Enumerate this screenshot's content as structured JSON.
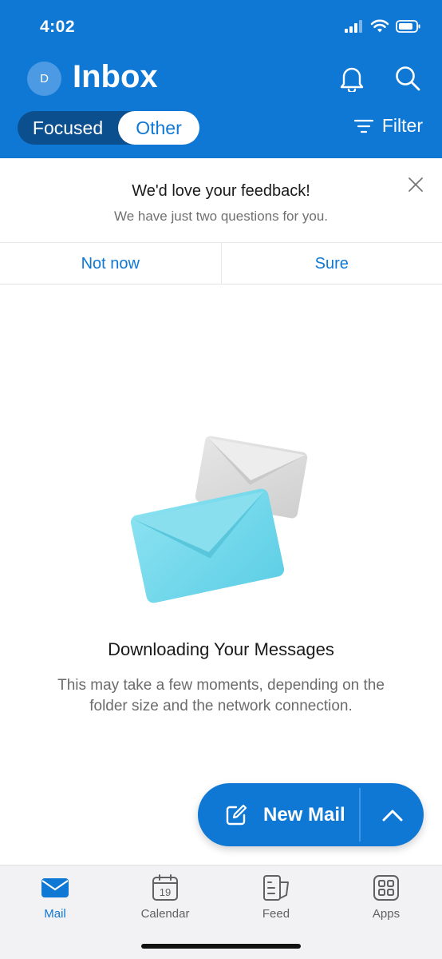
{
  "status": {
    "time": "4:02"
  },
  "header": {
    "avatar_initial": "D",
    "title": "Inbox",
    "tabs": {
      "focused": "Focused",
      "other": "Other",
      "selected": "Other"
    },
    "filter_label": "Filter"
  },
  "feedback": {
    "title": "We'd love your feedback!",
    "subtitle": "We have just two questions for you.",
    "not_now": "Not now",
    "sure": "Sure"
  },
  "empty_state": {
    "title": "Downloading Your Messages",
    "subtitle": "This may take a few moments, depending on the folder size and the network connection."
  },
  "fab": {
    "label": "New Mail"
  },
  "nav": {
    "items": [
      {
        "label": "Mail",
        "icon": "mail-icon",
        "active": true
      },
      {
        "label": "Calendar",
        "icon": "calendar-icon",
        "day": "19"
      },
      {
        "label": "Feed",
        "icon": "feed-icon"
      },
      {
        "label": "Apps",
        "icon": "apps-icon"
      }
    ]
  },
  "colors": {
    "brand": "#0f78d4",
    "toggle_track": "#0b4f8f",
    "envelope_front": "#6fd6ea",
    "envelope_back": "#d9d9d9"
  }
}
